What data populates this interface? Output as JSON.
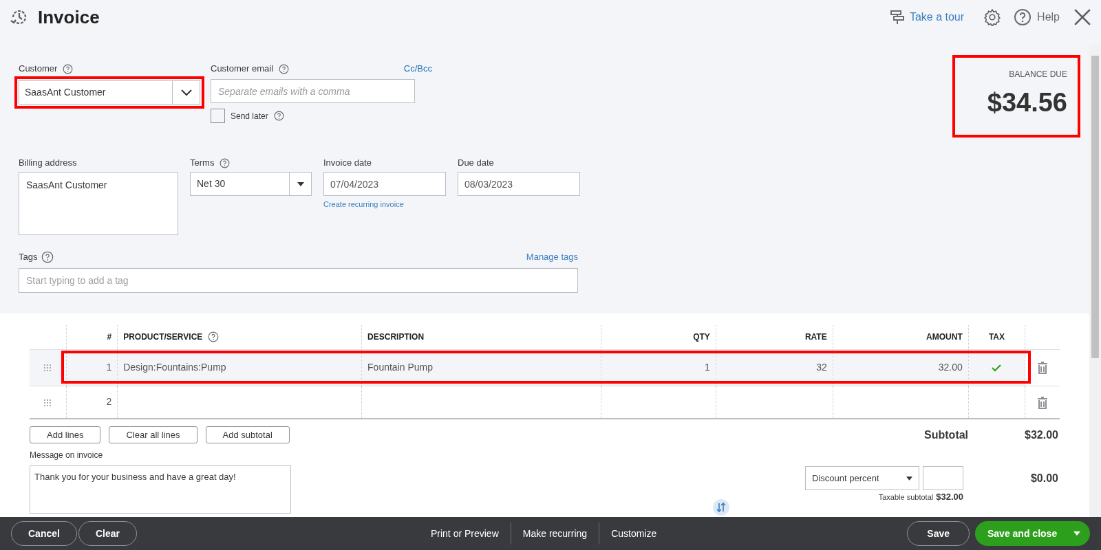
{
  "header": {
    "title": "Invoice",
    "tour": "Take a tour",
    "help": "Help"
  },
  "customer": {
    "label": "Customer",
    "value": "SaasAnt Customer",
    "highlighted": true
  },
  "email": {
    "label": "Customer email",
    "placeholder": "Separate emails with a comma",
    "cc_link": "Cc/Bcc"
  },
  "send_later": {
    "label": "Send later",
    "checked": false
  },
  "balance": {
    "label": "BALANCE DUE",
    "amount": "$34.56",
    "highlighted": true
  },
  "billing": {
    "label": "Billing address",
    "value": "SaasAnt Customer"
  },
  "terms": {
    "label": "Terms",
    "value": "Net 30"
  },
  "invoice_date": {
    "label": "Invoice date",
    "value": "07/04/2023",
    "link": "Create recurring invoice"
  },
  "due_date": {
    "label": "Due date",
    "value": "08/03/2023"
  },
  "tags": {
    "label": "Tags",
    "placeholder": "Start typing to add a tag",
    "manage_link": "Manage tags"
  },
  "table": {
    "columns": [
      {
        "label": "#"
      },
      {
        "label": "PRODUCT/SERVICE",
        "help": true
      },
      {
        "label": "DESCRIPTION"
      },
      {
        "label": "QTY"
      },
      {
        "label": "RATE"
      },
      {
        "label": "AMOUNT"
      },
      {
        "label": "TAX"
      }
    ],
    "rows": [
      {
        "number": "1",
        "product": "Design:Fountains:Pump",
        "description": "Fountain Pump",
        "qty": "1",
        "rate": "32",
        "amount": "32.00",
        "tax": true,
        "highlighted": true
      },
      {
        "number": "2",
        "tax": false,
        "highlighted": false
      }
    ]
  },
  "line_buttons": [
    "Add lines",
    "Clear all lines",
    "Add subtotal"
  ],
  "subtotal": {
    "label": "Subtotal",
    "value": "$32.00"
  },
  "message": {
    "label": "Message on invoice",
    "value": "Thank you for your business and have a great day!"
  },
  "discount": {
    "type": "Discount percent",
    "value": "$0.00"
  },
  "taxable": {
    "label": "Taxable subtotal",
    "value": "$32.00"
  },
  "footer": {
    "left": [
      "Cancel",
      "Clear"
    ],
    "center": [
      "Print or Preview",
      "Make recurring",
      "Customize"
    ],
    "save": "Save",
    "save_close": "Save and close"
  }
}
